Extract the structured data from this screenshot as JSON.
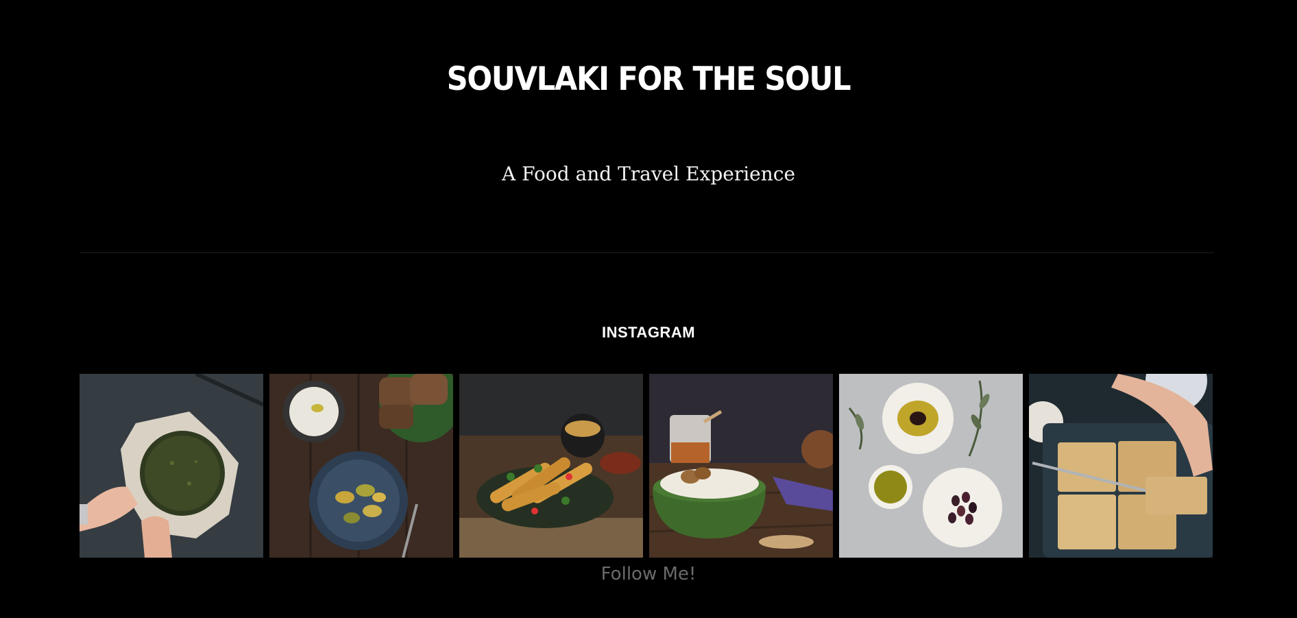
{
  "site": {
    "title": "SOUVLAKI FOR THE SOUL",
    "tagline": "A Food and Travel Experience"
  },
  "instagram": {
    "heading": "INSTAGRAM",
    "follow_label": "Follow Me!",
    "photos": [
      {
        "name": "spinach-pie-photo"
      },
      {
        "name": "tzatziki-zucchini-photo"
      },
      {
        "name": "spring-rolls-photo"
      },
      {
        "name": "yogurt-honey-walnuts-photo"
      },
      {
        "name": "olive-oil-olives-photo"
      },
      {
        "name": "spanakopita-tray-photo"
      }
    ]
  },
  "colors": {
    "background": "#000000",
    "text": "#ffffff",
    "follow_link": "#6b6b6b"
  }
}
